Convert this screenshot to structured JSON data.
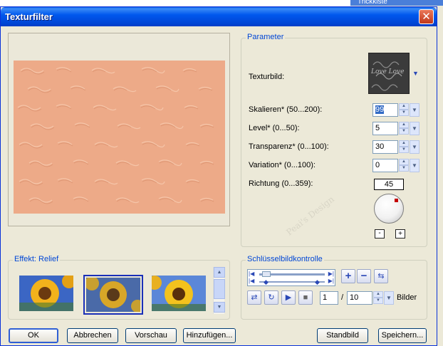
{
  "window": {
    "title": "Texturfilter",
    "close_glyph": "✕"
  },
  "background_app": {
    "label": "Trickkiste"
  },
  "parameter_group": {
    "label": "Parameter",
    "texture_label": "Texturbild:",
    "texture_dropdown_glyph": "▼",
    "fields": [
      {
        "label": "Skalieren* (50...200):",
        "value": "99"
      },
      {
        "label": "Level* (0...50):",
        "value": "5"
      },
      {
        "label": "Transparenz* (0...100):",
        "value": "30"
      },
      {
        "label": "Variation* (0...100):",
        "value": "0"
      }
    ],
    "direction": {
      "label": "Richtung (0...359):",
      "value": "45",
      "minus": "-",
      "plus": "+"
    },
    "watermark": "Peai's Design"
  },
  "effect_group": {
    "label": "Effekt: Relief"
  },
  "keyframe_group": {
    "label": "Schlüsselbildkontrolle",
    "frame_current": "1",
    "frame_separator": "/",
    "frame_total": "10",
    "frames_label": "Bilder"
  },
  "buttons": {
    "ok": "OK",
    "cancel": "Abbrechen",
    "preview": "Vorschau",
    "add": "Hinzufügen...",
    "default": "Standbild",
    "save": "Speichern..."
  },
  "texture_image_text": "Love Love",
  "colors": {
    "titlebar": "#0058ee",
    "dialog_bg": "#ece9d8",
    "preview_fill": "#edaa88",
    "accent": "#0046d5"
  }
}
